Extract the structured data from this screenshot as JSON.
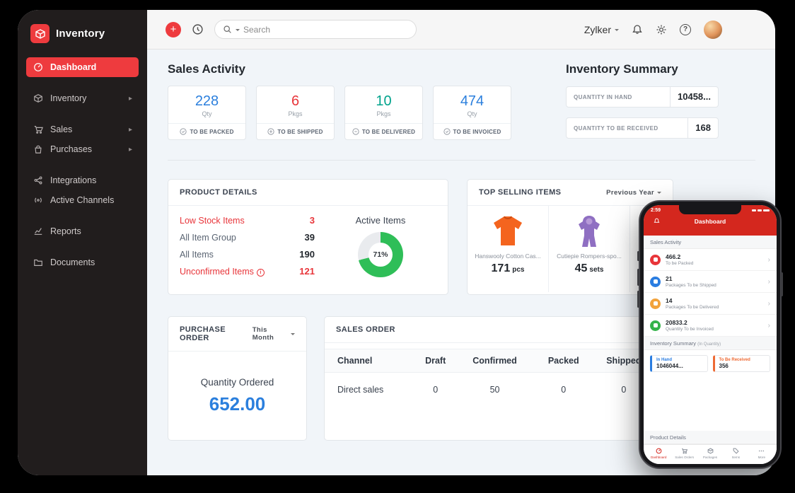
{
  "app": {
    "brand": "Inventory"
  },
  "sidebar": {
    "items": [
      {
        "label": "Dashboard"
      },
      {
        "label": "Inventory"
      },
      {
        "label": "Sales"
      },
      {
        "label": "Purchases"
      },
      {
        "label": "Integrations"
      },
      {
        "label": "Active Channels"
      },
      {
        "label": "Reports"
      },
      {
        "label": "Documents"
      }
    ]
  },
  "topbar": {
    "search_placeholder": "Search",
    "org": "Zylker"
  },
  "sales_activity": {
    "title": "Sales Activity",
    "cards": [
      {
        "value": "228",
        "unit": "Qty",
        "label": "TO BE PACKED",
        "color": "#2b7fdd"
      },
      {
        "value": "6",
        "unit": "Pkgs",
        "label": "TO BE SHIPPED",
        "color": "#e8353a"
      },
      {
        "value": "10",
        "unit": "Pkgs",
        "label": "TO BE DELIVERED",
        "color": "#00a38c"
      },
      {
        "value": "474",
        "unit": "Qty",
        "label": "TO BE INVOICED",
        "color": "#2b7fdd"
      }
    ]
  },
  "inventory_summary": {
    "title": "Inventory Summary",
    "cards": [
      {
        "label": "QUANTITY IN HAND",
        "value": "10458..."
      },
      {
        "label": "QUANTITY TO BE RECEIVED",
        "value": "168"
      }
    ]
  },
  "product_details": {
    "title": "PRODUCT DETAILS",
    "rows": [
      {
        "label": "Low Stock Items",
        "value": "3",
        "alert": true
      },
      {
        "label": "All Item Group",
        "value": "39",
        "alert": false
      },
      {
        "label": "All Items",
        "value": "190",
        "alert": false
      },
      {
        "label": "Unconfirmed Items",
        "value": "121",
        "alert": true
      }
    ],
    "donut": {
      "label": "Active Items",
      "value": 71,
      "percent": "71%",
      "color": "#2fbe58",
      "track": "#e9ebee"
    }
  },
  "top_selling": {
    "title": "TOP SELLING ITEMS",
    "filter": "Previous Year",
    "items": [
      {
        "name": "Hanswooly Cotton Cas...",
        "qty": "171",
        "unit": "pcs"
      },
      {
        "name": "Cutiepie Rompers-spo...",
        "qty": "45",
        "unit": "sets"
      }
    ]
  },
  "purchase_order": {
    "title": "PURCHASE ORDER",
    "filter": "This Month",
    "label": "Quantity Ordered",
    "value": "652.00"
  },
  "sales_order": {
    "title": "SALES ORDER",
    "columns": [
      "Channel",
      "Draft",
      "Confirmed",
      "Packed",
      "Shipped"
    ],
    "rows": [
      {
        "channel": "Direct sales",
        "draft": "0",
        "confirmed": "50",
        "packed": "0",
        "shipped": "0"
      }
    ]
  },
  "phone": {
    "time": "2:59",
    "title": "Dashboard",
    "sections": {
      "sales_activity": "Sales Activity",
      "inventory_summary": "Inventory Summary",
      "inventory_summary_sub": "(In Quantity)",
      "product_details": "Product Details"
    },
    "items": [
      {
        "value": "466.2",
        "label": "To be Packed",
        "color": "#e8353a"
      },
      {
        "value": "21",
        "label": "Packages To be Shipped",
        "color": "#2a7de1"
      },
      {
        "value": "14",
        "label": "Packages To be Delivered",
        "color": "#f2a33c"
      },
      {
        "value": "20833.2",
        "label": "Quantity To be Invoiced",
        "color": "#35b34a"
      }
    ],
    "inventory_cards": [
      {
        "label": "In Hand",
        "value": "1046044...",
        "accent": "#2a7de1"
      },
      {
        "label": "To Be Received",
        "value": "356",
        "accent": "#ee6a34"
      }
    ],
    "tabs": [
      {
        "label": "Dashboard"
      },
      {
        "label": "Sales Orders"
      },
      {
        "label": "Packages"
      },
      {
        "label": "Items"
      },
      {
        "label": "More"
      }
    ]
  },
  "colors": {
    "accent_red": "#ee3b3e",
    "blue": "#2b7fdd",
    "teal": "#00a38c",
    "green": "#2fbe58",
    "phone_red": "#d4271e"
  }
}
